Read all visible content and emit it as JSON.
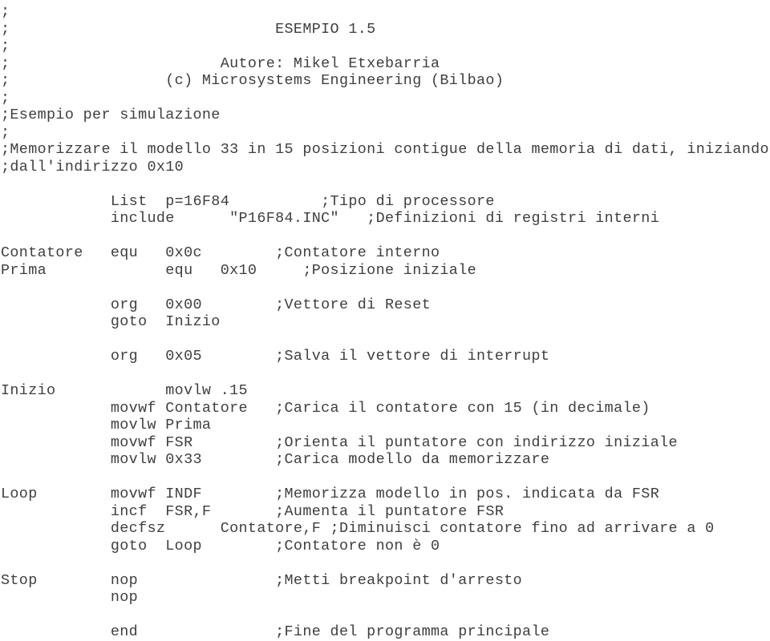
{
  "document": {
    "title": "ESEMPIO 1.5",
    "language": "pic-assembly",
    "author": "Mikel Etxebarria",
    "company": "Microsystems Engineering (Bilbao)",
    "text_color": "#3f3f3f",
    "background_color": "#ffffff"
  },
  "lines": [
    ";",
    ";                             ESEMPIO 1.5",
    ";",
    ";                       Autore: Mikel Etxebarria",
    ";                 (c) Microsystems Engineering (Bilbao)",
    ";",
    ";Esempio per simulazione",
    ";",
    ";Memorizzare il modello 33 in 15 posizioni contigue della memoria di dati, iniziando",
    ";dall'indirizzo 0x10",
    "",
    "            List  p=16F84          ;Tipo di processore",
    "            include      \"P16F84.INC\"   ;Definizioni di registri interni",
    "",
    "Contatore   equ   0x0c        ;Contatore interno",
    "Prima             equ   0x10     ;Posizione iniziale",
    "",
    "            org   0x00        ;Vettore di Reset",
    "            goto  Inizio",
    "",
    "            org   0x05        ;Salva il vettore di interrupt",
    "",
    "Inizio            movlw .15",
    "            movwf Contatore   ;Carica il contatore con 15 (in decimale)",
    "            movlw Prima",
    "            movwf FSR         ;Orienta il puntatore con indirizzo iniziale",
    "            movlw 0x33        ;Carica modello da memorizzare",
    "",
    "Loop        movwf INDF        ;Memorizza modello in pos. indicata da FSR",
    "            incf  FSR,F       ;Aumenta il puntatore FSR",
    "            decfsz      Contatore,F ;Diminuisci contatore fino ad arrivare a 0",
    "            goto  Loop        ;Contatore non è 0",
    "",
    "Stop        nop               ;Metti breakpoint d'arresto",
    "            nop",
    "",
    "            end               ;Fine del programma principale"
  ]
}
